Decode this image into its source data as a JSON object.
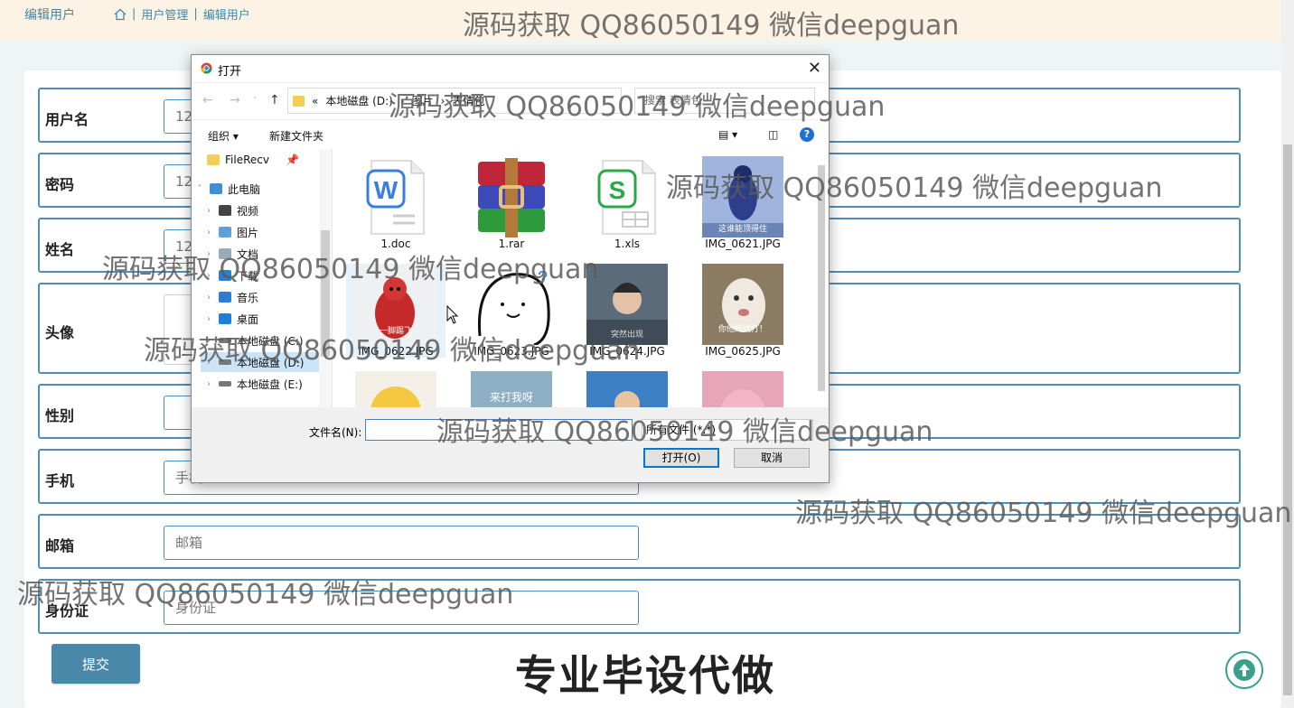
{
  "page": {
    "title": "编辑用户",
    "breadcrumb": [
      "用户管理",
      "编辑用户"
    ]
  },
  "form": {
    "username": {
      "label": "用户名",
      "value": "12"
    },
    "password": {
      "label": "密码",
      "value": "12"
    },
    "name": {
      "label": "姓名",
      "value": "12"
    },
    "avatar": {
      "label": "头像"
    },
    "gender": {
      "label": "性别",
      "value": ""
    },
    "phone": {
      "label": "手机",
      "placeholder": "手机"
    },
    "email": {
      "label": "邮箱",
      "placeholder": "邮箱"
    },
    "idcard": {
      "label": "身份证",
      "placeholder": "身份证"
    },
    "submit_label": "提交"
  },
  "overlay_text": "专业毕设代做",
  "watermark": "源码获取 QQ86050149 微信deepguan",
  "dialog": {
    "title": "打开",
    "path": [
      "«",
      "本地磁盘 (D:)",
      "›",
      "图片",
      "›",
      "表情包"
    ],
    "search_placeholder": "搜索 表情包",
    "toolbar": {
      "organize": "组织 ▾",
      "new_folder": "新建文件夹",
      "help": "?"
    },
    "sidebar": [
      {
        "label": "FileRecv",
        "icon": "folder-icon",
        "pinned": true
      },
      {
        "label": "此电脑",
        "icon": "computer-icon"
      },
      {
        "label": "视频",
        "icon": "video-icon"
      },
      {
        "label": "图片",
        "icon": "pictures-icon"
      },
      {
        "label": "文档",
        "icon": "documents-icon"
      },
      {
        "label": "下载",
        "icon": "download-icon"
      },
      {
        "label": "音乐",
        "icon": "music-icon"
      },
      {
        "label": "桌面",
        "icon": "desktop-icon"
      },
      {
        "label": "本地磁盘 (C:)",
        "icon": "drive-icon"
      },
      {
        "label": "本地磁盘 (D:)",
        "icon": "drive-icon"
      },
      {
        "label": "本地磁盘 (E:)",
        "icon": "drive-icon"
      }
    ],
    "files": [
      {
        "name": "1.doc",
        "icon": "word-doc-icon"
      },
      {
        "name": "1.rar",
        "icon": "winrar-archive-icon"
      },
      {
        "name": "1.xls",
        "icon": "spreadsheet-icon"
      },
      {
        "name": "IMG_0621.JPG",
        "caption": "这谁能顶得住"
      },
      {
        "name": "IMG_0622.JPG",
        "caption": "一脚踢飞"
      },
      {
        "name": "IMG_0623.JPG"
      },
      {
        "name": "IMG_0624.JPG",
        "caption": "突然出现"
      },
      {
        "name": "IMG_0625.JPG",
        "caption": "你他妈找打！"
      },
      {
        "name": "",
        "caption": ""
      },
      {
        "name": "",
        "caption": "来打我呀"
      },
      {
        "name": ""
      },
      {
        "name": ""
      }
    ],
    "filename_label": "文件名(N):",
    "filetype": "所有文件 (*.*)",
    "open_label": "打开(O)",
    "cancel_label": "取消"
  },
  "colors": {
    "accent": "#4a90ba",
    "topbar": "#fdf3e4",
    "submit": "#4a88a9",
    "totop": "#3aa08a"
  }
}
